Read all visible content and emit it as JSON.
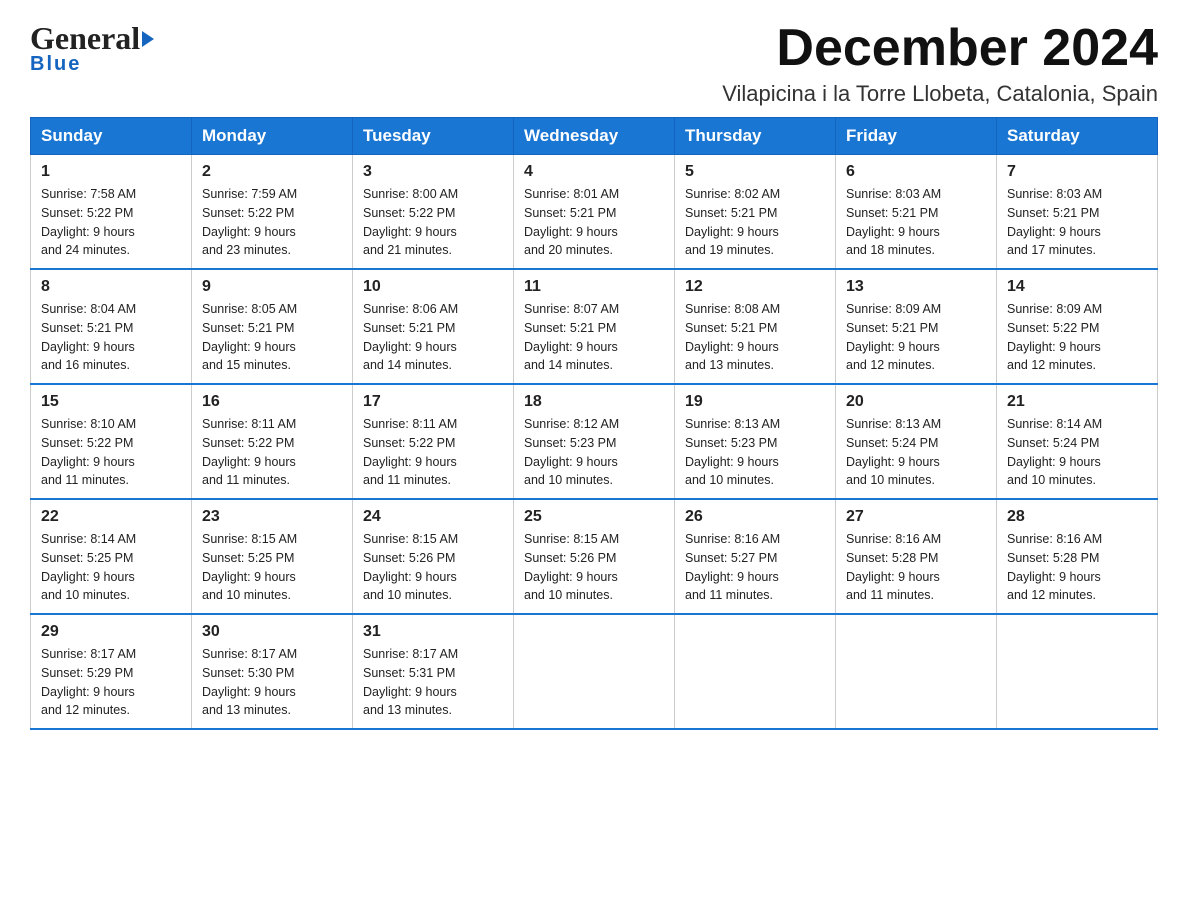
{
  "header": {
    "logo_general": "General",
    "logo_blue": "Blue",
    "title": "December 2024",
    "subtitle": "Vilapicina i la Torre Llobeta, Catalonia, Spain"
  },
  "days_of_week": [
    "Sunday",
    "Monday",
    "Tuesday",
    "Wednesday",
    "Thursday",
    "Friday",
    "Saturday"
  ],
  "weeks": [
    [
      {
        "day": "1",
        "sunrise": "7:58 AM",
        "sunset": "5:22 PM",
        "daylight": "9 hours and 24 minutes."
      },
      {
        "day": "2",
        "sunrise": "7:59 AM",
        "sunset": "5:22 PM",
        "daylight": "9 hours and 23 minutes."
      },
      {
        "day": "3",
        "sunrise": "8:00 AM",
        "sunset": "5:22 PM",
        "daylight": "9 hours and 21 minutes."
      },
      {
        "day": "4",
        "sunrise": "8:01 AM",
        "sunset": "5:21 PM",
        "daylight": "9 hours and 20 minutes."
      },
      {
        "day": "5",
        "sunrise": "8:02 AM",
        "sunset": "5:21 PM",
        "daylight": "9 hours and 19 minutes."
      },
      {
        "day": "6",
        "sunrise": "8:03 AM",
        "sunset": "5:21 PM",
        "daylight": "9 hours and 18 minutes."
      },
      {
        "day": "7",
        "sunrise": "8:03 AM",
        "sunset": "5:21 PM",
        "daylight": "9 hours and 17 minutes."
      }
    ],
    [
      {
        "day": "8",
        "sunrise": "8:04 AM",
        "sunset": "5:21 PM",
        "daylight": "9 hours and 16 minutes."
      },
      {
        "day": "9",
        "sunrise": "8:05 AM",
        "sunset": "5:21 PM",
        "daylight": "9 hours and 15 minutes."
      },
      {
        "day": "10",
        "sunrise": "8:06 AM",
        "sunset": "5:21 PM",
        "daylight": "9 hours and 14 minutes."
      },
      {
        "day": "11",
        "sunrise": "8:07 AM",
        "sunset": "5:21 PM",
        "daylight": "9 hours and 14 minutes."
      },
      {
        "day": "12",
        "sunrise": "8:08 AM",
        "sunset": "5:21 PM",
        "daylight": "9 hours and 13 minutes."
      },
      {
        "day": "13",
        "sunrise": "8:09 AM",
        "sunset": "5:21 PM",
        "daylight": "9 hours and 12 minutes."
      },
      {
        "day": "14",
        "sunrise": "8:09 AM",
        "sunset": "5:22 PM",
        "daylight": "9 hours and 12 minutes."
      }
    ],
    [
      {
        "day": "15",
        "sunrise": "8:10 AM",
        "sunset": "5:22 PM",
        "daylight": "9 hours and 11 minutes."
      },
      {
        "day": "16",
        "sunrise": "8:11 AM",
        "sunset": "5:22 PM",
        "daylight": "9 hours and 11 minutes."
      },
      {
        "day": "17",
        "sunrise": "8:11 AM",
        "sunset": "5:22 PM",
        "daylight": "9 hours and 11 minutes."
      },
      {
        "day": "18",
        "sunrise": "8:12 AM",
        "sunset": "5:23 PM",
        "daylight": "9 hours and 10 minutes."
      },
      {
        "day": "19",
        "sunrise": "8:13 AM",
        "sunset": "5:23 PM",
        "daylight": "9 hours and 10 minutes."
      },
      {
        "day": "20",
        "sunrise": "8:13 AM",
        "sunset": "5:24 PM",
        "daylight": "9 hours and 10 minutes."
      },
      {
        "day": "21",
        "sunrise": "8:14 AM",
        "sunset": "5:24 PM",
        "daylight": "9 hours and 10 minutes."
      }
    ],
    [
      {
        "day": "22",
        "sunrise": "8:14 AM",
        "sunset": "5:25 PM",
        "daylight": "9 hours and 10 minutes."
      },
      {
        "day": "23",
        "sunrise": "8:15 AM",
        "sunset": "5:25 PM",
        "daylight": "9 hours and 10 minutes."
      },
      {
        "day": "24",
        "sunrise": "8:15 AM",
        "sunset": "5:26 PM",
        "daylight": "9 hours and 10 minutes."
      },
      {
        "day": "25",
        "sunrise": "8:15 AM",
        "sunset": "5:26 PM",
        "daylight": "9 hours and 10 minutes."
      },
      {
        "day": "26",
        "sunrise": "8:16 AM",
        "sunset": "5:27 PM",
        "daylight": "9 hours and 11 minutes."
      },
      {
        "day": "27",
        "sunrise": "8:16 AM",
        "sunset": "5:28 PM",
        "daylight": "9 hours and 11 minutes."
      },
      {
        "day": "28",
        "sunrise": "8:16 AM",
        "sunset": "5:28 PM",
        "daylight": "9 hours and 12 minutes."
      }
    ],
    [
      {
        "day": "29",
        "sunrise": "8:17 AM",
        "sunset": "5:29 PM",
        "daylight": "9 hours and 12 minutes."
      },
      {
        "day": "30",
        "sunrise": "8:17 AM",
        "sunset": "5:30 PM",
        "daylight": "9 hours and 13 minutes."
      },
      {
        "day": "31",
        "sunrise": "8:17 AM",
        "sunset": "5:31 PM",
        "daylight": "9 hours and 13 minutes."
      },
      null,
      null,
      null,
      null
    ]
  ],
  "labels": {
    "sunrise": "Sunrise:",
    "sunset": "Sunset:",
    "daylight": "Daylight:"
  }
}
